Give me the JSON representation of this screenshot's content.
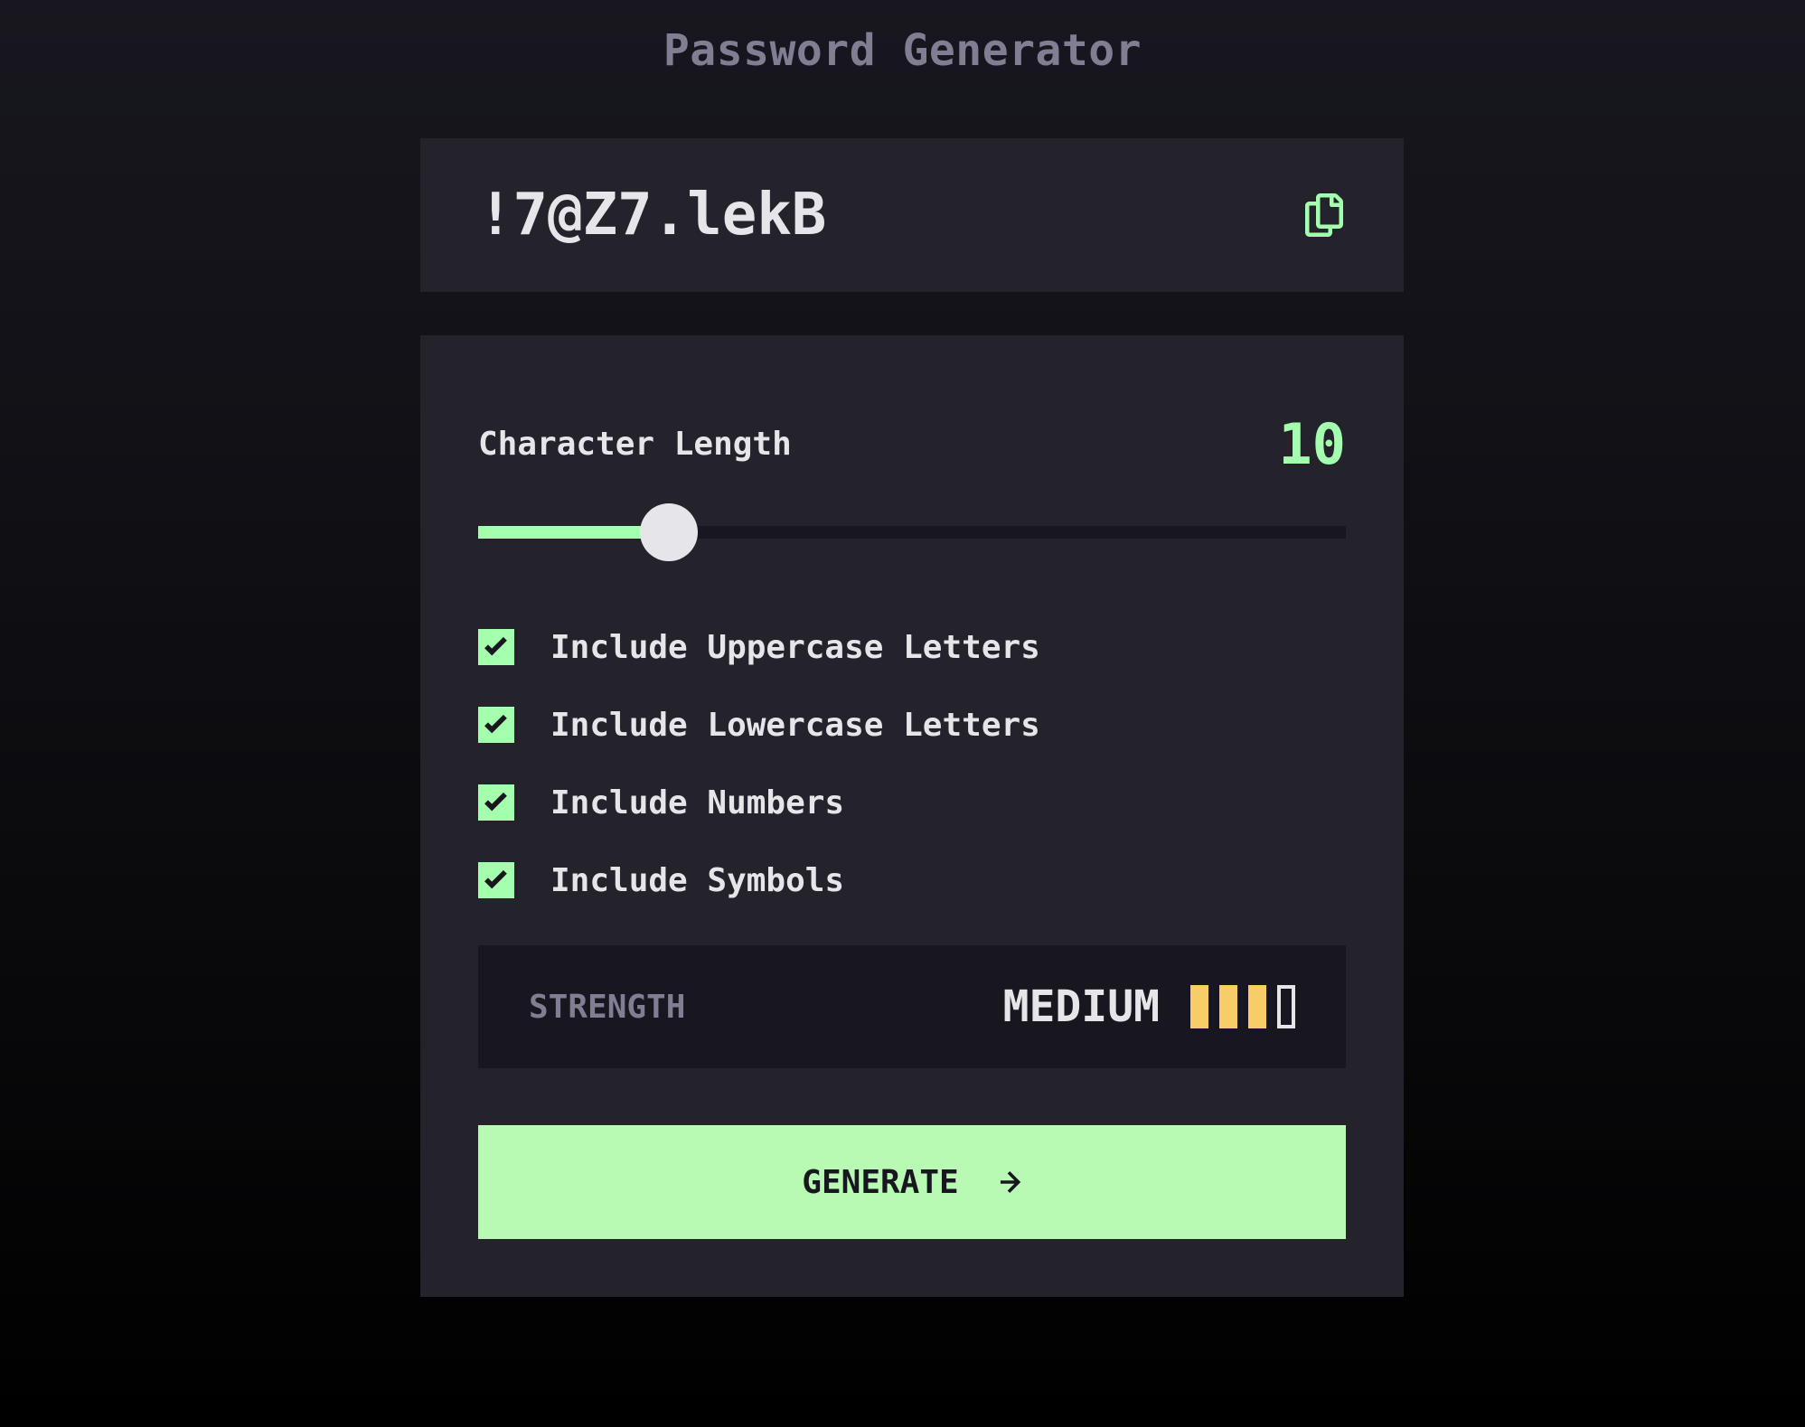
{
  "app": {
    "title": "Password Generator"
  },
  "output": {
    "password": "!7@Z7.lekB",
    "copy_icon": "copy-icon"
  },
  "settings": {
    "length_label": "Character Length",
    "length_value": "10",
    "length_slider_level": 0.22
  },
  "options": [
    {
      "label": "Include Uppercase Letters",
      "checked": true
    },
    {
      "label": "Include Lowercase Letters",
      "checked": true
    },
    {
      "label": "Include Numbers",
      "checked": true
    },
    {
      "label": "Include Symbols",
      "checked": true
    }
  ],
  "strength": {
    "label": "STRENGTH",
    "rating": "MEDIUM",
    "level": 3,
    "max_level": 4
  },
  "generate": {
    "label": "GENERATE",
    "icon": "arrow-right-icon"
  },
  "colors": {
    "accent_green": "#a4ffaf",
    "strength_yellow": "#f8cd65",
    "panel_bg": "#24232c",
    "dark_bg": "#18171f",
    "muted_text": "#817d92",
    "text": "#e6e5ea"
  }
}
